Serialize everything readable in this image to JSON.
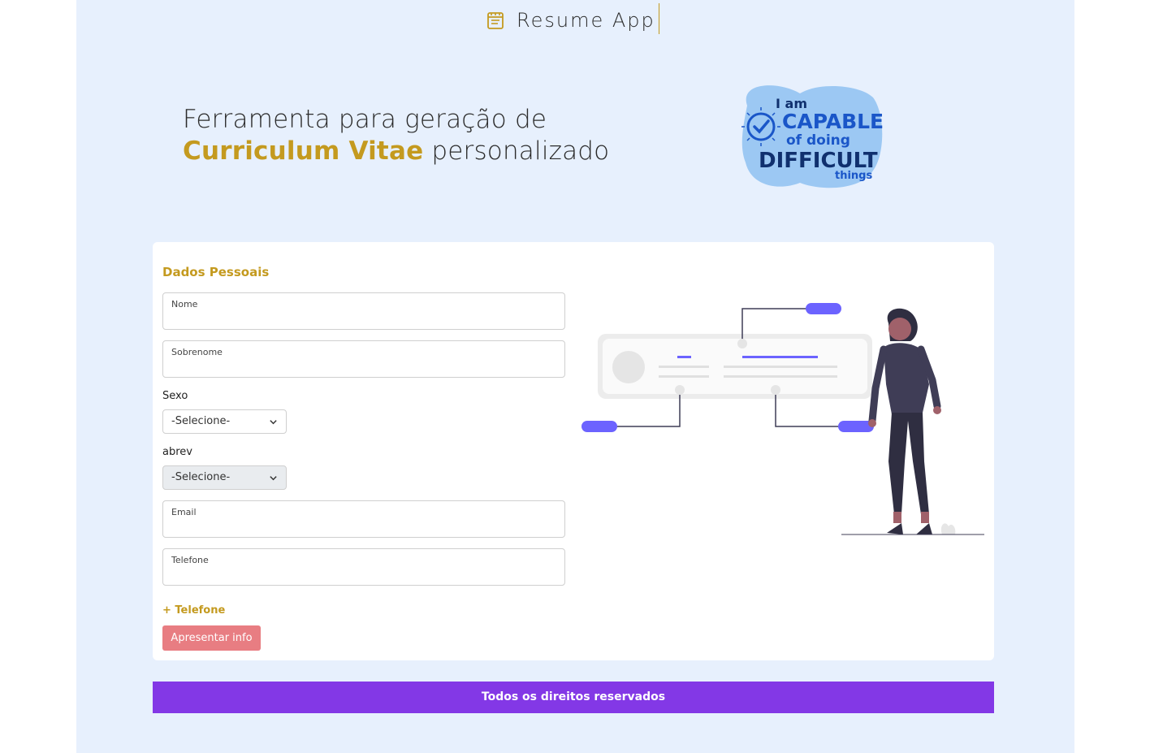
{
  "header": {
    "title": "Resume App",
    "icon": "notepad-icon",
    "accent_color": "#c49a1f"
  },
  "hero": {
    "line1": "Ferramenta para geração de",
    "accent_text": "Curriculum Vitae",
    "line2_rest": " personalizado",
    "badge": {
      "line1": "I am",
      "line2": "CAPABLE",
      "line3": "of doing",
      "line4": "DIFFICULT",
      "line5": "things"
    }
  },
  "form": {
    "section_title": "Dados Pessoais",
    "nome_label": "Nome",
    "sobrenome_label": "Sobrenome",
    "sexo_label": "Sexo",
    "sexo_selected": "-Selecione-",
    "abrev_label": "abrev",
    "abrev_selected": "-Selecione-",
    "email_label": "Email",
    "telefone_label": "Telefone",
    "add_phone": "+ Telefone",
    "submit_label": "Apresentar info",
    "submit_color": "#e87d82"
  },
  "footer": {
    "text": "Todos os direitos reservados",
    "color": "#8338e6"
  }
}
